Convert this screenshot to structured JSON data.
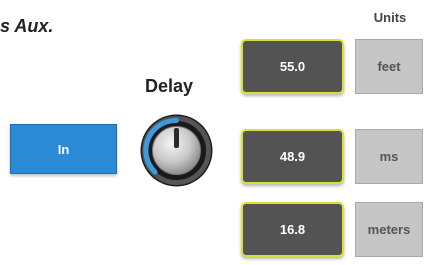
{
  "heading": "s Aux.",
  "units_header": "Units",
  "delay_label": "Delay",
  "in_button": "In",
  "rows": [
    {
      "value": "55.0",
      "unit": "feet"
    },
    {
      "value": "48.9",
      "unit": "ms"
    },
    {
      "value": "16.8",
      "unit": "meters"
    }
  ],
  "colors": {
    "in_button": "#2b8ad6",
    "value_box": "#535353",
    "value_border": "#d8e235",
    "unit_box": "#c6c6c6",
    "knob_ring": "#3a9ce0"
  }
}
